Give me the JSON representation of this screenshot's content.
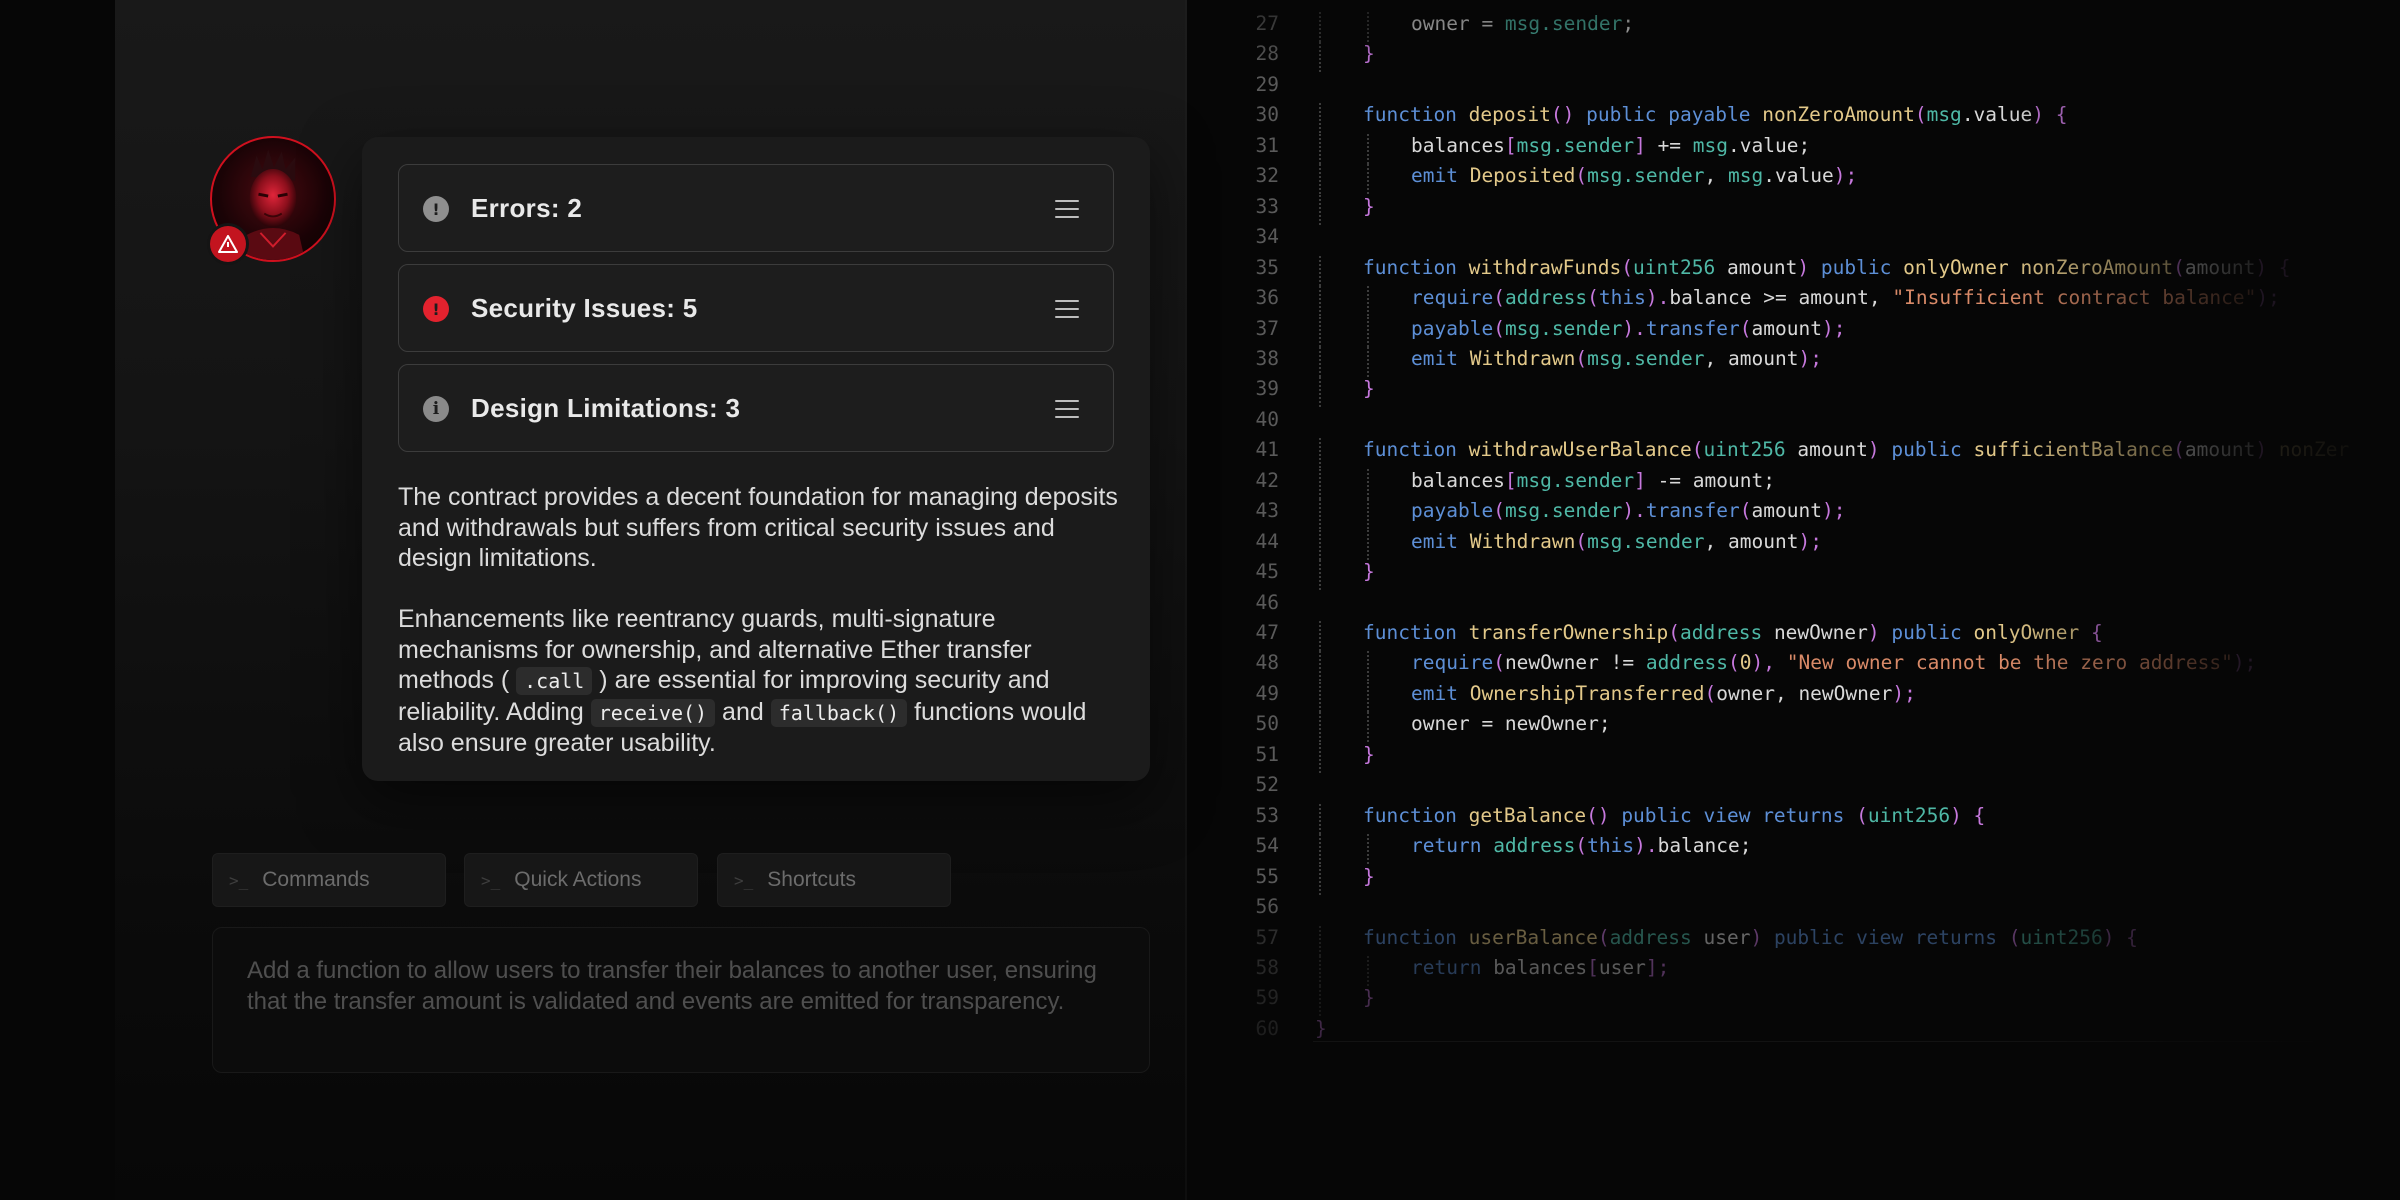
{
  "review": {
    "issues": [
      {
        "label": "Errors: 2",
        "icon": "exclamation-icon",
        "color": "#8f8f8f"
      },
      {
        "label": "Security Issues: 5",
        "icon": "alert-icon",
        "color": "#e3222e"
      },
      {
        "label": "Design Limitations: 3",
        "icon": "info-icon",
        "color": "#8a8a8a"
      }
    ],
    "summary_p1": "The contract provides a decent foundation for managing deposits and withdrawals but suffers from critical security issues and design limitations.",
    "summary_p2_a": "Enhancements like reentrancy guards, multi-signature mechanisms for ownership, and alternative Ether transfer methods (",
    "summary_p2_code1": ".call",
    "summary_p2_b": ") are essential for improving security and reliability. Adding",
    "summary_p2_code2": "receive()",
    "summary_p2_c": "and",
    "summary_p2_code3": "fallback()",
    "summary_p2_d": "functions would also ensure greater usability."
  },
  "tabs": [
    {
      "prompt": ">_",
      "label": "Commands"
    },
    {
      "prompt": ">_",
      "label": "Quick Actions"
    },
    {
      "prompt": ">_",
      "label": "Shortcuts"
    }
  ],
  "input": {
    "value": "Add a function to allow users to transfer their balances to another user, ensuring that the transfer amount is validated and events are emitted for transparency."
  },
  "colors": {
    "accent": "#d0101e",
    "keyword": "#5d8fd6",
    "function": "#e3c98a",
    "type": "#4fb8a6",
    "string": "#d98a68",
    "identifier": "#d9d9d9",
    "brace": "#c678dd"
  },
  "code_lines": [
    {
      "num": "27",
      "indent": 2,
      "tokens": [
        [
          "owner = ",
          "identifier"
        ],
        [
          "msg.sender",
          "type"
        ],
        [
          ";",
          "identifier"
        ]
      ]
    },
    {
      "num": "28",
      "indent": 1,
      "tokens": [
        [
          "}",
          "brace"
        ]
      ]
    },
    {
      "num": "29",
      "indent": 0,
      "tokens": []
    },
    {
      "num": "30",
      "indent": 1,
      "tokens": [
        [
          "function ",
          "keyword"
        ],
        [
          "deposit",
          "function"
        ],
        [
          "() ",
          "brace"
        ],
        [
          "public payable ",
          "keyword"
        ],
        [
          "nonZeroAmount",
          "function"
        ],
        [
          "(",
          "brace"
        ],
        [
          "msg",
          "type"
        ],
        [
          ".value",
          "identifier"
        ],
        [
          ") {",
          "brace"
        ]
      ]
    },
    {
      "num": "31",
      "indent": 2,
      "tokens": [
        [
          "balances",
          "identifier"
        ],
        [
          "[",
          "brace"
        ],
        [
          "msg.sender",
          "type"
        ],
        [
          "] ",
          "brace"
        ],
        [
          "+= ",
          "identifier"
        ],
        [
          "msg",
          "type"
        ],
        [
          ".value;",
          "identifier"
        ]
      ]
    },
    {
      "num": "32",
      "indent": 2,
      "tokens": [
        [
          "emit ",
          "keyword"
        ],
        [
          "Deposited",
          "function"
        ],
        [
          "(",
          "brace"
        ],
        [
          "msg.sender",
          "type"
        ],
        [
          ", ",
          "identifier"
        ],
        [
          "msg",
          "type"
        ],
        [
          ".value",
          "identifier"
        ],
        [
          ");",
          "brace"
        ]
      ]
    },
    {
      "num": "33",
      "indent": 1,
      "tokens": [
        [
          "}",
          "brace"
        ]
      ]
    },
    {
      "num": "34",
      "indent": 0,
      "tokens": []
    },
    {
      "num": "35",
      "indent": 1,
      "tokens": [
        [
          "function ",
          "keyword"
        ],
        [
          "withdrawFunds",
          "function"
        ],
        [
          "(",
          "brace"
        ],
        [
          "uint256 ",
          "type"
        ],
        [
          "amount",
          "identifier"
        ],
        [
          ") ",
          "brace"
        ],
        [
          "public ",
          "keyword"
        ],
        [
          "onlyOwner ",
          "function"
        ],
        [
          "nonZeroAmount",
          "function"
        ],
        [
          "(",
          "brace"
        ],
        [
          "amount",
          "identifier"
        ],
        [
          ") {",
          "brace"
        ]
      ]
    },
    {
      "num": "36",
      "indent": 2,
      "tokens": [
        [
          "require",
          "keyword"
        ],
        [
          "(",
          "brace"
        ],
        [
          "address",
          "type"
        ],
        [
          "(",
          "brace"
        ],
        [
          "this",
          "keyword"
        ],
        [
          ").",
          "brace"
        ],
        [
          "balance >= amount, ",
          "identifier"
        ],
        [
          "\"Insufficient contract balance\"",
          "string"
        ],
        [
          ");",
          "brace"
        ]
      ]
    },
    {
      "num": "37",
      "indent": 2,
      "tokens": [
        [
          "payable",
          "keyword"
        ],
        [
          "(",
          "brace"
        ],
        [
          "msg.sender",
          "type"
        ],
        [
          ").",
          "brace"
        ],
        [
          "transfer",
          "keyword"
        ],
        [
          "(",
          "brace"
        ],
        [
          "amount",
          "identifier"
        ],
        [
          ");",
          "brace"
        ]
      ]
    },
    {
      "num": "38",
      "indent": 2,
      "tokens": [
        [
          "emit ",
          "keyword"
        ],
        [
          "Withdrawn",
          "function"
        ],
        [
          "(",
          "brace"
        ],
        [
          "msg.sender",
          "type"
        ],
        [
          ", amount",
          "identifier"
        ],
        [
          ");",
          "brace"
        ]
      ]
    },
    {
      "num": "39",
      "indent": 1,
      "tokens": [
        [
          "}",
          "brace"
        ]
      ]
    },
    {
      "num": "40",
      "indent": 0,
      "tokens": []
    },
    {
      "num": "41",
      "indent": 1,
      "tokens": [
        [
          "function ",
          "keyword"
        ],
        [
          "withdrawUserBalance",
          "function"
        ],
        [
          "(",
          "brace"
        ],
        [
          "uint256 ",
          "type"
        ],
        [
          "amount",
          "identifier"
        ],
        [
          ") ",
          "brace"
        ],
        [
          "public ",
          "keyword"
        ],
        [
          "sufficientBalance",
          "function"
        ],
        [
          "(",
          "brace"
        ],
        [
          "amount",
          "identifier"
        ],
        [
          ") ",
          "brace"
        ],
        [
          "nonZer",
          "function"
        ]
      ]
    },
    {
      "num": "42",
      "indent": 2,
      "tokens": [
        [
          "balances",
          "identifier"
        ],
        [
          "[",
          "brace"
        ],
        [
          "msg.sender",
          "type"
        ],
        [
          "] ",
          "brace"
        ],
        [
          "-= amount;",
          "identifier"
        ]
      ]
    },
    {
      "num": "43",
      "indent": 2,
      "tokens": [
        [
          "payable",
          "keyword"
        ],
        [
          "(",
          "brace"
        ],
        [
          "msg.sender",
          "type"
        ],
        [
          ").",
          "brace"
        ],
        [
          "transfer",
          "keyword"
        ],
        [
          "(",
          "brace"
        ],
        [
          "amount",
          "identifier"
        ],
        [
          ");",
          "brace"
        ]
      ]
    },
    {
      "num": "44",
      "indent": 2,
      "tokens": [
        [
          "emit ",
          "keyword"
        ],
        [
          "Withdrawn",
          "function"
        ],
        [
          "(",
          "brace"
        ],
        [
          "msg.sender",
          "type"
        ],
        [
          ", amount",
          "identifier"
        ],
        [
          ");",
          "brace"
        ]
      ]
    },
    {
      "num": "45",
      "indent": 1,
      "tokens": [
        [
          "}",
          "brace"
        ]
      ]
    },
    {
      "num": "46",
      "indent": 0,
      "tokens": []
    },
    {
      "num": "47",
      "indent": 1,
      "tokens": [
        [
          "function ",
          "keyword"
        ],
        [
          "transferOwnership",
          "function"
        ],
        [
          "(",
          "brace"
        ],
        [
          "address ",
          "type"
        ],
        [
          "newOwner",
          "identifier"
        ],
        [
          ") ",
          "brace"
        ],
        [
          "public ",
          "keyword"
        ],
        [
          "onlyOwner ",
          "function"
        ],
        [
          "{",
          "brace"
        ]
      ]
    },
    {
      "num": "48",
      "indent": 2,
      "tokens": [
        [
          "require",
          "keyword"
        ],
        [
          "(",
          "brace"
        ],
        [
          "newOwner != ",
          "identifier"
        ],
        [
          "address",
          "type"
        ],
        [
          "(",
          "brace"
        ],
        [
          "0",
          "function"
        ],
        [
          "), ",
          "brace"
        ],
        [
          "\"New owner cannot be the zero address\"",
          "string"
        ],
        [
          ");",
          "brace"
        ]
      ]
    },
    {
      "num": "49",
      "indent": 2,
      "tokens": [
        [
          "emit ",
          "keyword"
        ],
        [
          "OwnershipTransferred",
          "function"
        ],
        [
          "(",
          "brace"
        ],
        [
          "owner, newOwner",
          "identifier"
        ],
        [
          ");",
          "brace"
        ]
      ]
    },
    {
      "num": "50",
      "indent": 2,
      "tokens": [
        [
          "owner = newOwner;",
          "identifier"
        ]
      ]
    },
    {
      "num": "51",
      "indent": 1,
      "tokens": [
        [
          "}",
          "brace"
        ]
      ]
    },
    {
      "num": "52",
      "indent": 0,
      "tokens": []
    },
    {
      "num": "53",
      "indent": 1,
      "tokens": [
        [
          "function ",
          "keyword"
        ],
        [
          "getBalance",
          "function"
        ],
        [
          "() ",
          "brace"
        ],
        [
          "public view returns ",
          "keyword"
        ],
        [
          "(",
          "brace"
        ],
        [
          "uint256",
          "type"
        ],
        [
          ") {",
          "brace"
        ]
      ]
    },
    {
      "num": "54",
      "indent": 2,
      "tokens": [
        [
          "return ",
          "keyword"
        ],
        [
          "address",
          "type"
        ],
        [
          "(",
          "brace"
        ],
        [
          "this",
          "keyword"
        ],
        [
          ").",
          "brace"
        ],
        [
          "balance;",
          "identifier"
        ]
      ]
    },
    {
      "num": "55",
      "indent": 1,
      "tokens": [
        [
          "}",
          "brace"
        ]
      ]
    },
    {
      "num": "56",
      "indent": 0,
      "tokens": []
    },
    {
      "num": "57",
      "indent": 1,
      "tokens": [
        [
          "function ",
          "keyword"
        ],
        [
          "userBalance",
          "function"
        ],
        [
          "(",
          "brace"
        ],
        [
          "address ",
          "type"
        ],
        [
          "user",
          "identifier"
        ],
        [
          ") ",
          "brace"
        ],
        [
          "public view returns ",
          "keyword"
        ],
        [
          "(",
          "brace"
        ],
        [
          "uint256",
          "type"
        ],
        [
          ") {",
          "brace"
        ]
      ]
    },
    {
      "num": "58",
      "indent": 2,
      "tokens": [
        [
          "return ",
          "keyword"
        ],
        [
          "balances",
          "identifier"
        ],
        [
          "[",
          "brace"
        ],
        [
          "user",
          "identifier"
        ],
        [
          "];",
          "brace"
        ]
      ]
    },
    {
      "num": "59",
      "indent": 1,
      "tokens": [
        [
          "}",
          "brace"
        ]
      ]
    },
    {
      "num": "60",
      "indent": 0,
      "tokens": [
        [
          "}",
          "brace"
        ]
      ]
    }
  ]
}
